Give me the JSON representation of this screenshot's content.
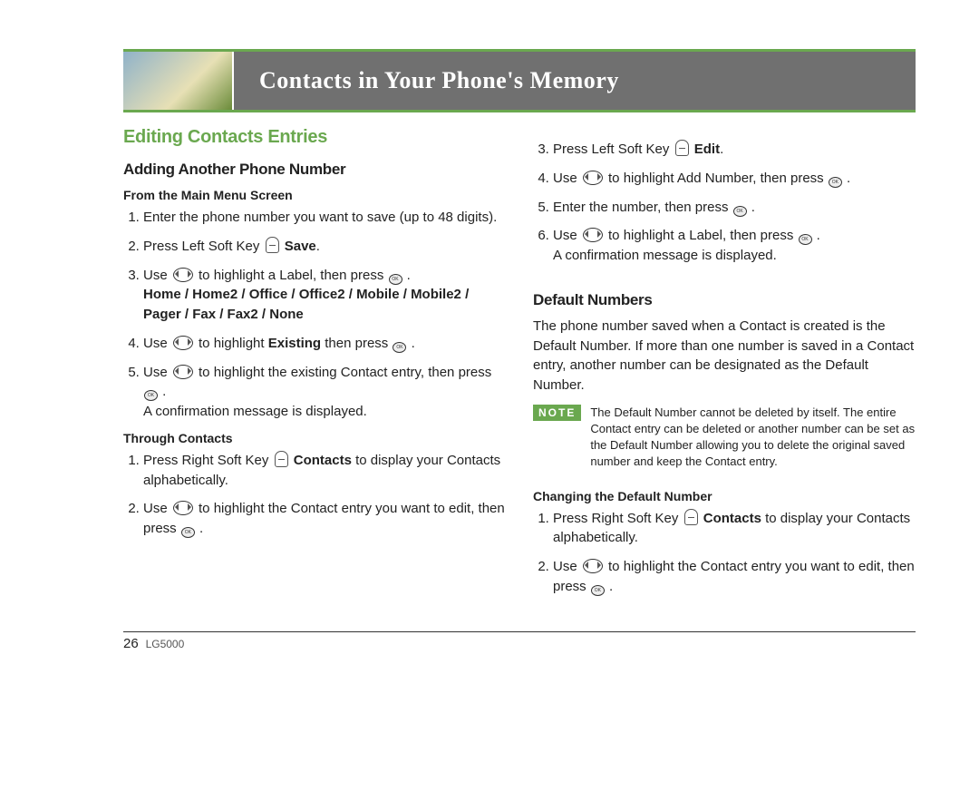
{
  "header": {
    "title": "Contacts in Your Phone's Memory"
  },
  "left": {
    "section_title": "Editing Contacts Entries",
    "sub1": "Adding Another Phone Number",
    "from_main": "From the Main Menu Screen",
    "s1_1": "Enter the phone number you want to save (up to 48 digits).",
    "s1_2a": "Press Left Soft Key ",
    "s1_2b": " Save",
    "s1_2c": ".",
    "s1_3a": "Use ",
    "s1_3b": " to highlight a Label, then press ",
    "s1_3c": " .",
    "labels": "Home / Home2 / Office / Office2 / Mobile / Mobile2 / Pager / Fax / Fax2 / None",
    "s1_4a": "Use ",
    "s1_4b": " to highlight ",
    "s1_4c": "Existing",
    "s1_4d": " then press ",
    "s1_4e": " .",
    "s1_5a": "Use ",
    "s1_5b": " to highlight the existing Contact entry, then press ",
    "s1_5c": " .",
    "s1_5_confirm": "A confirmation message is displayed.",
    "through_contacts": "Through Contacts",
    "tc_1a": "Press Right Soft Key ",
    "tc_1b": " Contacts",
    "tc_1c": " to display your Contacts alphabetically.",
    "tc_2a": "Use ",
    "tc_2b": " to highlight the Contact entry you want to edit, then press ",
    "tc_2c": " ."
  },
  "right": {
    "r3a": "Press Left Soft Key ",
    "r3b": " Edit",
    "r3c": ".",
    "r4a": "Use ",
    "r4b": " to highlight Add Number, then press ",
    "r4c": " .",
    "r5a": "Enter the number, then press ",
    "r5b": " .",
    "r6a": "Use ",
    "r6b": " to highlight a Label, then press ",
    "r6c": " .",
    "r6_confirm": "A confirmation message is displayed.",
    "default_title": "Default Numbers",
    "default_para": "The phone number saved when a Contact is created is the Default Number. If more than one number is saved in a Contact entry, another number can be designated as the Default Number.",
    "note_label": "NOTE",
    "note_text": "The Default Number cannot be deleted by itself. The entire Contact entry can be deleted or another number can be set as the Default Number allowing you to delete the original saved number and keep the Contact entry.",
    "changing": "Changing the Default Number",
    "c1a": "Press Right Soft Key ",
    "c1b": " Contacts",
    "c1c": " to display your Contacts alphabetically.",
    "c2a": "Use ",
    "c2b": " to highlight the Contact entry you want to edit, then press ",
    "c2c": " ."
  },
  "footer": {
    "page": "26",
    "model": "LG5000"
  }
}
